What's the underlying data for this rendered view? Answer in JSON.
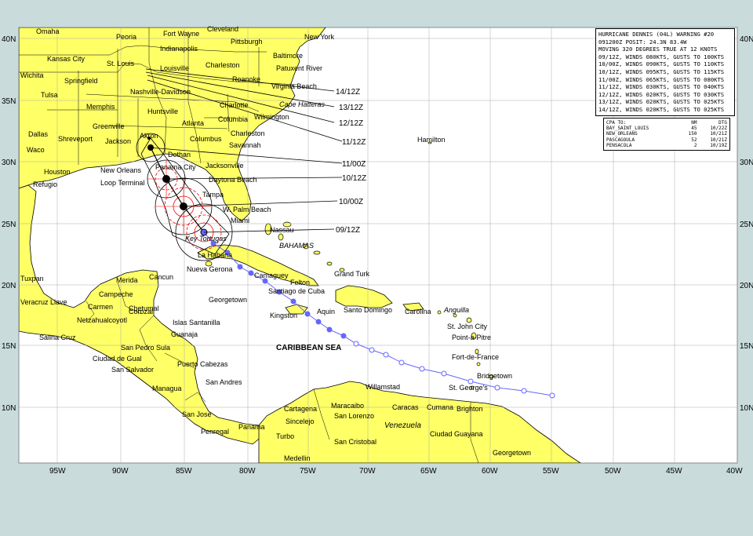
{
  "map": {
    "lat_ticks": [
      "40N",
      "35N",
      "30N",
      "25N",
      "20N",
      "15N",
      "10N"
    ],
    "lon_ticks": [
      "95W",
      "90W",
      "85W",
      "80W",
      "75W",
      "70W",
      "65W",
      "60W",
      "55W",
      "50W",
      "45W",
      "40W"
    ],
    "track_times": [
      "14/12Z",
      "13/12Z",
      "12/12Z",
      "11/12Z",
      "11/00Z",
      "10/12Z",
      "10/00Z",
      "09/12Z"
    ],
    "cities": [
      "Omaha",
      "Peoria",
      "Fort Wayne",
      "Cleveland",
      "Pittsburgh",
      "New York",
      "Kansas City",
      "St. Louis",
      "Indianapolis",
      "Baltimore",
      "Charleston",
      "Patuxent River",
      "Wichita",
      "Springfield",
      "Louisville",
      "Roanoke",
      "Virginia Beach",
      "Tulsa",
      "Nashville-Davidson",
      "Memphis",
      "Huntsville",
      "Charlotte",
      "Cape Hatteras",
      "Wilmington",
      "Columbia",
      "Greenville",
      "Atlanta",
      "Dallas",
      "Shreveport",
      "Jackson",
      "Columbus",
      "Savannah",
      "Waco",
      "Akron",
      "Dothan",
      "Charleston",
      "Hamilton",
      "Houston",
      "New Orleans",
      "Panama City",
      "Jacksonville",
      "Refugio",
      "Loop Terminal",
      "Daytona Beach",
      "Tampa",
      "W. Palm Beach",
      "Miami",
      "Nassau",
      "Key Tortugas",
      "La Habana",
      "Nueva Gerona",
      "Grand Turk",
      "Camaguey",
      "Felton",
      "Tuxpan",
      "Merida",
      "Cancun",
      "Veracruz Llave",
      "Campeche",
      "Georgetown",
      "Santiago de Cuba",
      "Carmen",
      "Chetumal",
      "Kingston",
      "Aquin",
      "Santo Domingo",
      "Carolina",
      "Anguilla",
      "Netzahualcoyotl",
      "Corozal",
      "Islas Santanilla",
      "St. John City",
      "Salina Cruz",
      "Guanaja",
      "Point-a-Pitre",
      "San Pedro Sula",
      "Ciudad de Gual",
      "Fort-de-France",
      "San Salvador",
      "Puerto Cabezas",
      "Bridgetown",
      "Managua",
      "San Andres",
      "Willamstad",
      "St. George's",
      "Cartagena",
      "Maracaibo",
      "Caracas",
      "Cumana",
      "Brighton",
      "San Jose",
      "Sincelejo",
      "San Lorenzo",
      "Panama",
      "Penregal",
      "Turbo",
      "San Cristobal",
      "Ciudad Guayana",
      "Medellin",
      "Georgetown"
    ],
    "regions": [
      "BAHAMAS",
      "CARIBBEAN SEA",
      "Venezuela"
    ]
  },
  "warning": {
    "lines": [
      "HURRICANE DENNIS (04L) WARNING #20",
      "091200Z POSIT: 24.3N 83.4W",
      "MOVING 320 DEGREES TRUE AT 12 KNOTS",
      "09/12Z, WINDS 080KTS, GUSTS TO 100KTS",
      "10/00Z, WINDS 090KTS, GUSTS TO 110KTS",
      "10/12Z, WINDS 095KTS, GUSTS TO 115KTS",
      "11/00Z, WINDS 065KTS, GUSTS TO 080KTS",
      "11/12Z, WINDS 030KTS, GUSTS TO 040KTS",
      "12/12Z, WINDS 020KTS, GUSTS TO 030KTS",
      "13/12Z, WINDS 020KTS, GUSTS TO 025KTS",
      "14/12Z, WINDS 020KTS, GUSTS TO 025KTS"
    ]
  },
  "cpa": {
    "headers": [
      "CPA TO:",
      "NM",
      "DTG"
    ],
    "rows": [
      [
        "BAY_SAINT_LOUIS",
        "45",
        "10/22Z"
      ],
      [
        "NEW_ORLEANS",
        "150",
        "10/21Z"
      ],
      [
        "PASCAGOULA",
        "52",
        "10/21Z"
      ],
      [
        "PENSACOLA",
        "2",
        "10/19Z"
      ]
    ]
  },
  "colors": {
    "land": "#ffff66",
    "sea": "#ffffff",
    "frame": "#c9dbdb",
    "past_track": "#6666ff",
    "forecast": "#000000",
    "wind_radii": "#ff0000"
  }
}
